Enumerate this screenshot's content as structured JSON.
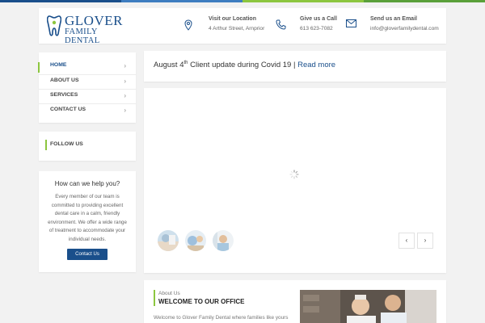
{
  "colors": {
    "accent": "#8cc63f",
    "brand": "#1a4f8b",
    "button": "#1a4f8b",
    "topbar": [
      "#1a4f8b",
      "#3e7dc0",
      "#8cc63f",
      "#5aa03a"
    ]
  },
  "logo": {
    "name": "GLOVER",
    "subtitle": "FAMILY DENTAL",
    "icon": "tooth-icon"
  },
  "header": {
    "location": {
      "icon": "map-pin-icon",
      "title": "Visit our Location",
      "value": "4 Arthur Street, Arnprior"
    },
    "phone": {
      "icon": "phone-icon",
      "title": "Give us a Call",
      "value": "613 623-7082"
    },
    "email": {
      "icon": "envelope-icon",
      "title": "Send us an Email",
      "value": "info@gloverfamilydental.com"
    }
  },
  "nav": {
    "items": [
      {
        "label": "HOME",
        "active": true
      },
      {
        "label": "ABOUT US"
      },
      {
        "label": "SERVICES"
      },
      {
        "label": "CONTACT US"
      }
    ],
    "chevron": "›"
  },
  "follow": {
    "label": "FOLLOW US"
  },
  "help": {
    "title": "How can we help you?",
    "text": "Every member of our team is committed to providing excellent dental care in a calm, friendly environment. We offer a wide range of treatment to accommodate your individual needs.",
    "button": "Contact Us"
  },
  "notice": {
    "prefix": "August 4",
    "sup": "th",
    "text": " Client update during Covid 19 | ",
    "link": "Read more"
  },
  "slider": {
    "prev": "‹",
    "next": "›"
  },
  "about": {
    "pre": "About Us",
    "title": "WELCOME TO OUR OFFICE",
    "text": "Welcome to Glover Family Dental where families like yours"
  }
}
